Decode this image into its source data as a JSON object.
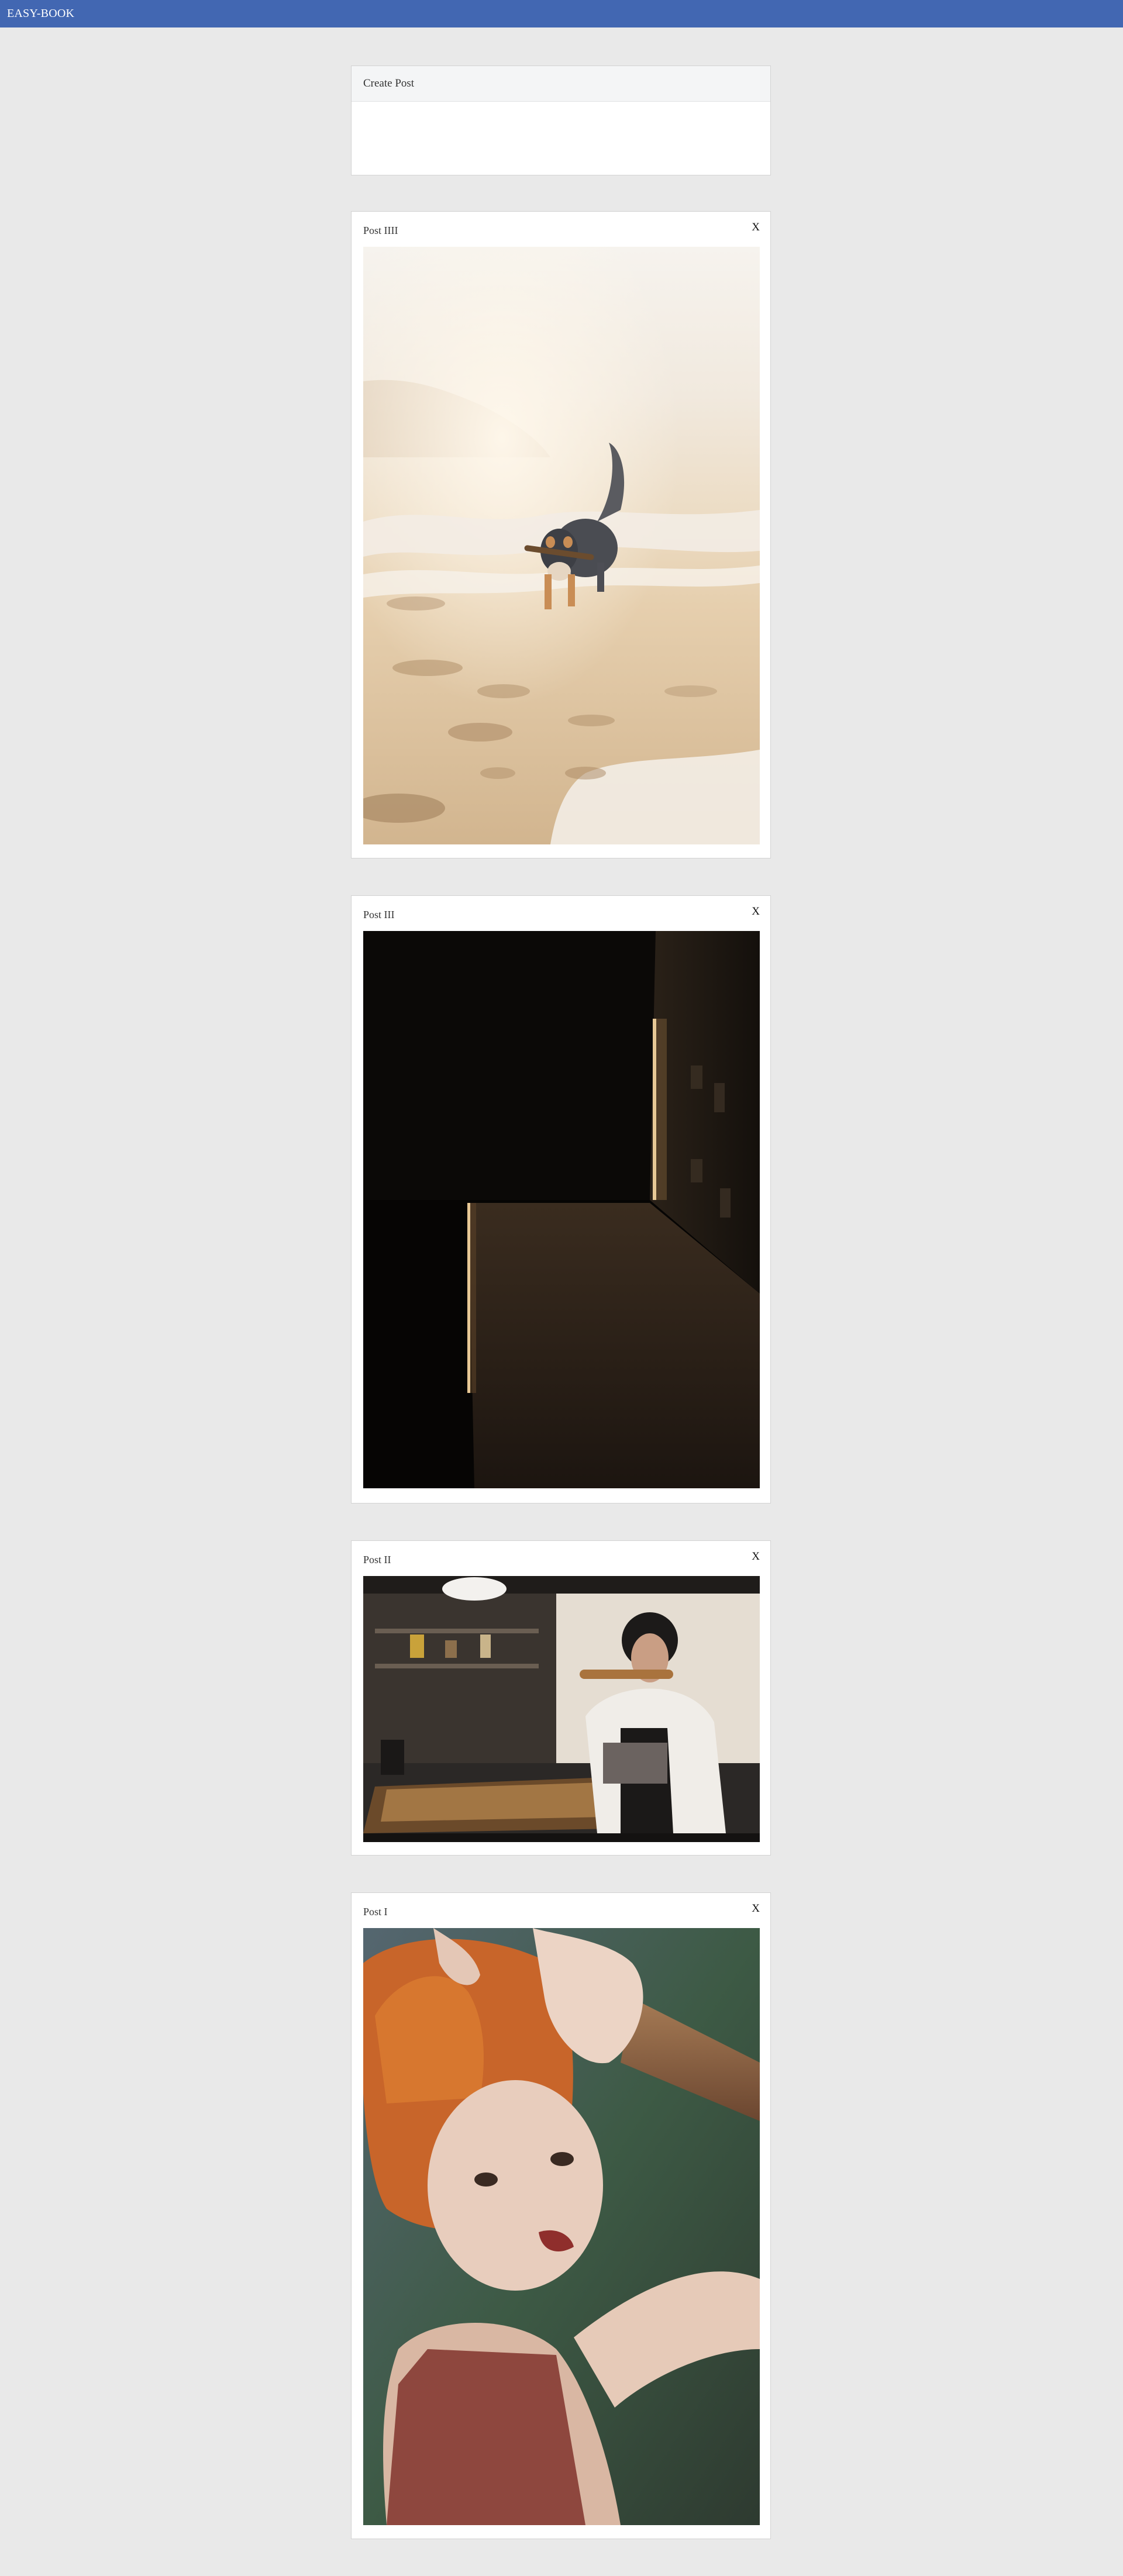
{
  "app": {
    "brand": "EASY-BOOK",
    "brand_color": "#4267b2"
  },
  "create_post": {
    "title": "Create Post"
  },
  "posts": [
    {
      "title": "Post IIII",
      "close_label": "X",
      "image": "photo-dog-on-beach"
    },
    {
      "title": "Post III",
      "close_label": "X",
      "image": "photo-dark-room-light-beam"
    },
    {
      "title": "Post II",
      "close_label": "X",
      "image": "photo-craftsman-workshop"
    },
    {
      "title": "Post I",
      "close_label": "X",
      "image": "photo-red-haired-woman-portrait"
    }
  ]
}
